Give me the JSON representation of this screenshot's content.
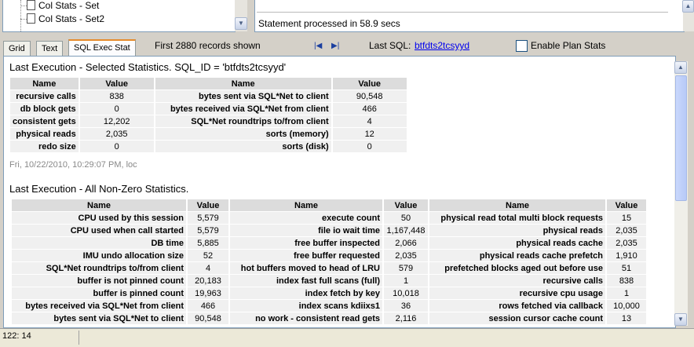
{
  "tree": {
    "items": [
      "Col Stats - Set",
      "Col Stats - Set2"
    ]
  },
  "status": {
    "message": "Statement processed in 58.9 secs"
  },
  "tabs": [
    {
      "label": "Grid"
    },
    {
      "label": "Text"
    },
    {
      "label": "SQL Exec Stat",
      "active": true
    }
  ],
  "toolbar": {
    "records_text": "First 2880 records shown",
    "nav_first_icon": "first-page-icon",
    "nav_last_icon": "last-page-icon",
    "last_sql_label": "Last SQL:",
    "last_sql_link": "btfdts2tcsyyd",
    "plan_stats_label": "Enable Plan Stats",
    "plan_stats_checked": false
  },
  "section1": {
    "title": "Last Execution - Selected Statistics. SQL_ID = 'btfdts2tcsyyd'",
    "headers": [
      "Name",
      "Value",
      "Name",
      "Value"
    ],
    "rows": [
      [
        "recursive calls",
        "838",
        "bytes sent via SQL*Net to client",
        "90,548"
      ],
      [
        "db block gets",
        "0",
        "bytes received via SQL*Net from client",
        "466"
      ],
      [
        "consistent gets",
        "12,202",
        "SQL*Net roundtrips to/from client",
        "4"
      ],
      [
        "physical reads",
        "2,035",
        "sorts (memory)",
        "12"
      ],
      [
        "redo size",
        "0",
        "sorts (disk)",
        "0"
      ]
    ],
    "timestamp": "Fri, 10/22/2010, 10:29:07 PM, loc"
  },
  "section2": {
    "title": "Last Execution - All Non-Zero Statistics.",
    "headers": [
      "Name",
      "Value",
      "Name",
      "Value",
      "Name",
      "Value"
    ],
    "rows": [
      [
        "CPU used by this session",
        "5,579",
        "execute count",
        "50",
        "physical read total multi block requests",
        "15"
      ],
      [
        "CPU used when call started",
        "5,579",
        "file io wait time",
        "1,167,448",
        "physical reads",
        "2,035"
      ],
      [
        "DB time",
        "5,885",
        "free buffer inspected",
        "2,066",
        "physical reads cache",
        "2,035"
      ],
      [
        "IMU undo allocation size",
        "52",
        "free buffer requested",
        "2,035",
        "physical reads cache prefetch",
        "1,910"
      ],
      [
        "SQL*Net roundtrips to/from client",
        "4",
        "hot buffers moved to head of LRU",
        "579",
        "prefetched blocks aged out before use",
        "51"
      ],
      [
        "buffer is not pinned count",
        "20,183",
        "index fast full scans (full)",
        "1",
        "recursive calls",
        "838"
      ],
      [
        "buffer is pinned count",
        "19,963",
        "index fetch by key",
        "10,018",
        "recursive cpu usage",
        "1"
      ],
      [
        "bytes received via SQL*Net from client",
        "466",
        "index scans kdiixs1",
        "36",
        "rows fetched via callback",
        "10,000"
      ],
      [
        "bytes sent via SQL*Net to client",
        "90,548",
        "no work - consistent read gets",
        "2,116",
        "session cursor cache count",
        "13"
      ]
    ]
  },
  "statusbar": {
    "position": "122: 14"
  }
}
